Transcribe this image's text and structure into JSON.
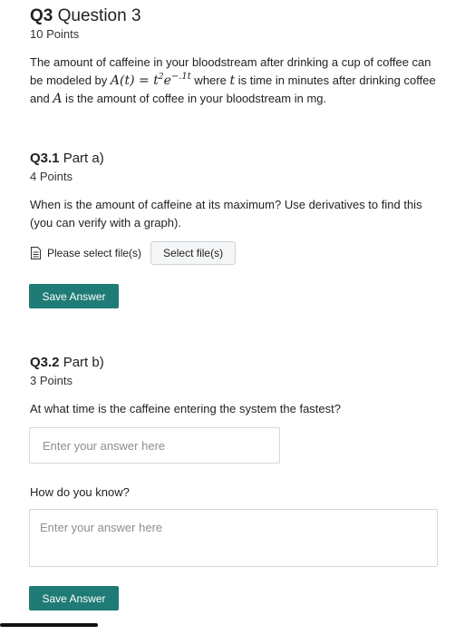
{
  "question": {
    "number": "Q3",
    "title": "Question 3",
    "points": "10 Points",
    "prompt": {
      "part1": "The amount of caffeine in your bloodstream after drinking a cup of coffee can be modeled by ",
      "formula_lhs": "A(t) = t",
      "formula_exp2": "2",
      "formula_e": "e",
      "formula_exp": "−.1t",
      "part2": " where ",
      "var_t": "t",
      "part3": " is time in minutes after drinking coffee and ",
      "var_A": "A",
      "part4": " is the amount of coffee in your bloodstream in mg."
    }
  },
  "part_a": {
    "number": "Q3.1",
    "title": "Part a)",
    "points": "4 Points",
    "prompt": "When is the amount of caffeine at its maximum? Use derivatives to find this (you can verify with a graph).",
    "upload_label": "Please select file(s)",
    "select_button": "Select file(s)",
    "save_button": "Save Answer"
  },
  "part_b": {
    "number": "Q3.2",
    "title": "Part b)",
    "points": "3 Points",
    "prompt": "At what time is the caffeine entering the system the fastest?",
    "answer_placeholder": "Enter your answer here",
    "followup": "How do you know?",
    "followup_placeholder": "Enter your answer here",
    "save_button": "Save Answer"
  },
  "icons": {
    "file": "file-icon"
  },
  "colors": {
    "accent": "#1f7b75",
    "text": "#222222",
    "border": "#d5d9dc"
  }
}
